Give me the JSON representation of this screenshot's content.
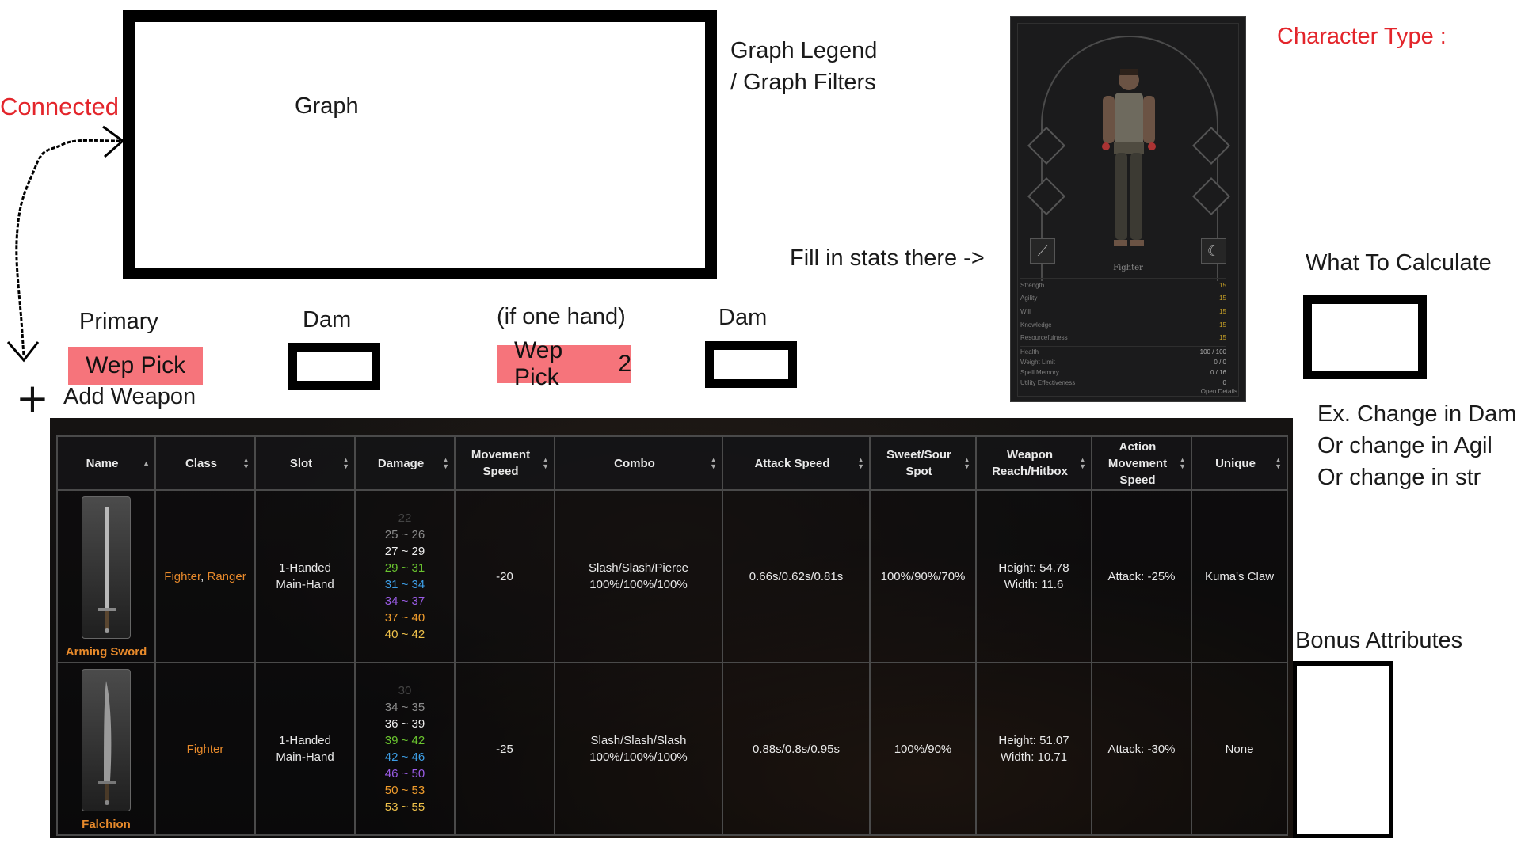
{
  "annotations": {
    "graph": "Graph",
    "graph_legend_1": "Graph Legend",
    "graph_legend_2": "/ Graph Filters",
    "connected": "Connected",
    "character_type": "Character Type :",
    "fill_in_stats": "Fill in stats there ->",
    "what_to_calculate": "What To Calculate",
    "ex_1": "Ex. Change in Dam",
    "ex_2": "Or change in Agil",
    "ex_3": "Or change in str",
    "bonus_attributes": "Bonus Attributes",
    "primary": "Primary",
    "dam_1": "Dam",
    "if_one_hand": "(if one hand)",
    "dam_2": "Dam",
    "wep_pick_1": "Wep Pick",
    "wep_pick_2": "Wep Pick",
    "wep_pick_2_suffix": "2",
    "add_weapon": "Add Weapon",
    "plus": "+"
  },
  "character": {
    "class": "Fighter",
    "stats": [
      {
        "label": "Strength",
        "value": "15"
      },
      {
        "label": "Agility",
        "value": "15"
      },
      {
        "label": "Will",
        "value": "15"
      },
      {
        "label": "Knowledge",
        "value": "15"
      },
      {
        "label": "Resourcefulness",
        "value": "15"
      }
    ],
    "derived": [
      {
        "label": "Health",
        "value": "100 / 100"
      },
      {
        "label": "Weight Limit",
        "value": "0 / 0"
      },
      {
        "label": "Spell Memory",
        "value": "0 / 16"
      },
      {
        "label": "Utility Effectiveness",
        "value": "0"
      }
    ],
    "open_details": "Open Details"
  },
  "table": {
    "headers": [
      "Name",
      "Class",
      "Slot",
      "Damage",
      "Movement Speed",
      "Combo",
      "Attack Speed",
      "Sweet/Sour Spot",
      "Weapon Reach/Hitbox",
      "Action Movement Speed",
      "Unique"
    ],
    "rows": [
      {
        "name": "Arming Sword",
        "class_1": "Fighter",
        "class_sep": ", ",
        "class_2": "Ranger",
        "slot_1": "1-Handed",
        "slot_2": "Main-Hand",
        "damage": [
          "22",
          "25 ~ 26",
          "27 ~ 29",
          "29 ~ 31",
          "31 ~ 34",
          "34 ~ 37",
          "37 ~ 40",
          "40 ~ 42"
        ],
        "movement_speed": "-20",
        "combo_1": "Slash/Slash/Pierce",
        "combo_2": "100%/100%/100%",
        "attack_speed": "0.66s/0.62s/0.81s",
        "sweet_spot": "100%/90%/70%",
        "reach_1": "Height: 54.78",
        "reach_2": "Width: 11.6",
        "action_speed": "Attack: -25%",
        "unique": "Kuma's Claw"
      },
      {
        "name": "Falchion",
        "class_1": "Fighter",
        "slot_1": "1-Handed",
        "slot_2": "Main-Hand",
        "damage": [
          "30",
          "34 ~ 35",
          "36 ~ 39",
          "39 ~ 42",
          "42 ~ 46",
          "46 ~ 50",
          "50 ~ 53",
          "53 ~ 55"
        ],
        "movement_speed": "-25",
        "combo_1": "Slash/Slash/Slash",
        "combo_2": "100%/100%/100%",
        "attack_speed": "0.88s/0.8s/0.95s",
        "sweet_spot": "100%/90%",
        "reach_1": "Height: 51.07",
        "reach_2": "Width: 10.71",
        "action_speed": "Attack: -30%",
        "unique": "None"
      }
    ]
  },
  "colors": {
    "annotation_red": "#e3252b",
    "wep_pick_pink": "#f6747b",
    "rarity_orange": "#e88a2b"
  }
}
